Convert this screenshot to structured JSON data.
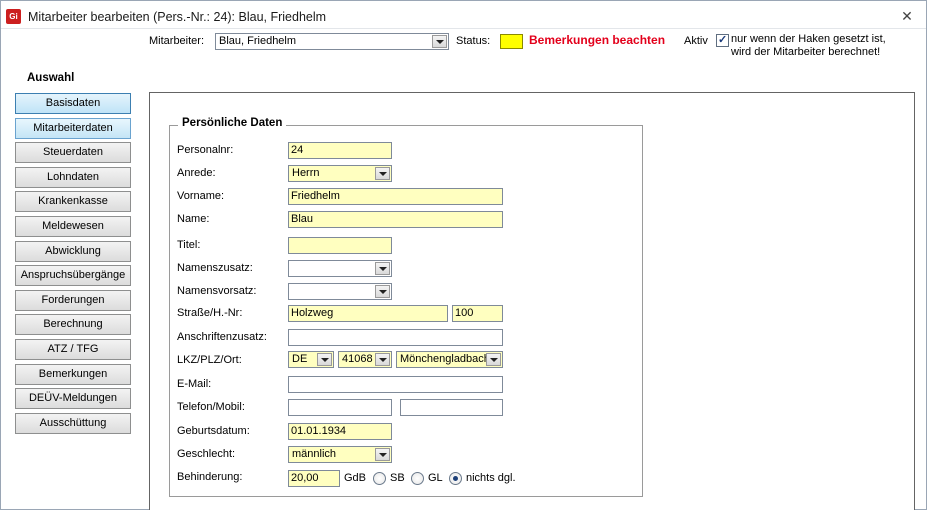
{
  "window": {
    "title": "Mitarbeiter bearbeiten (Pers.-Nr.: 24): Blau, Friedhelm",
    "app_icon_text": "Gi",
    "close_glyph": "✕"
  },
  "header": {
    "mitarbeiter_label": "Mitarbeiter:",
    "mitarbeiter_value": "Blau, Friedhelm",
    "status_label": "Status:",
    "status_color": "#ffff00",
    "status_text": "Bemerkungen beachten",
    "status_text_color": "#e3001b",
    "aktiv_label": "Aktiv",
    "aktiv_checked": true,
    "aktiv_note_line1": "nur wenn der Haken gesetzt ist,",
    "aktiv_note_line2": "wird der Mitarbeiter berechnet!"
  },
  "sidebar": {
    "title": "Auswahl",
    "items": [
      {
        "label": "Basisdaten",
        "state": "active"
      },
      {
        "label": "Mitarbeiterdaten",
        "state": "hover"
      },
      {
        "label": "Steuerdaten",
        "state": "normal"
      },
      {
        "label": "Lohndaten",
        "state": "normal"
      },
      {
        "label": "Krankenkasse",
        "state": "normal"
      },
      {
        "label": "Meldewesen",
        "state": "normal"
      },
      {
        "label": "Abwicklung",
        "state": "normal"
      },
      {
        "label": "Anspruchsübergänge",
        "state": "normal"
      },
      {
        "label": "Forderungen",
        "state": "normal"
      },
      {
        "label": "Berechnung",
        "state": "normal"
      },
      {
        "label": "ATZ / TFG",
        "state": "normal"
      },
      {
        "label": "Bemerkungen",
        "state": "normal"
      },
      {
        "label": "DEÜV-Meldungen",
        "state": "normal"
      },
      {
        "label": "Ausschüttung",
        "state": "normal"
      }
    ]
  },
  "form": {
    "group_title": "Persönliche Daten",
    "personalnr": {
      "label": "Personalnr:",
      "value": "24"
    },
    "anrede": {
      "label": "Anrede:",
      "value": "Herrn"
    },
    "vorname": {
      "label": "Vorname:",
      "value": "Friedhelm"
    },
    "name": {
      "label": "Name:",
      "value": "Blau"
    },
    "titel": {
      "label": "Titel:",
      "value": ""
    },
    "namenszusatz": {
      "label": "Namenszusatz:",
      "value": ""
    },
    "namensvorsatz": {
      "label": "Namensvorsatz:",
      "value": ""
    },
    "strasse": {
      "label": "Straße/H.-Nr:",
      "street": "Holzweg",
      "number": "100"
    },
    "anschriftenzusatz": {
      "label": "Anschriftenzusatz:",
      "value": ""
    },
    "ort": {
      "label": "LKZ/PLZ/Ort:",
      "lkz": "DE",
      "plz": "41068",
      "city": "Mönchengladbach"
    },
    "email": {
      "label": "E-Mail:",
      "value": ""
    },
    "telefon": {
      "label": "Telefon/Mobil:",
      "phone": "",
      "mobile": ""
    },
    "geburtsdatum": {
      "label": "Geburtsdatum:",
      "value": "01.01.1934"
    },
    "geschlecht": {
      "label": "Geschlecht:",
      "value": "männlich"
    },
    "behinderung": {
      "label": "Behinderung:",
      "value": "20,00",
      "gdb_label": "GdB",
      "options": [
        "SB",
        "GL",
        "nichts dgl."
      ],
      "selected": "nichts dgl."
    }
  }
}
